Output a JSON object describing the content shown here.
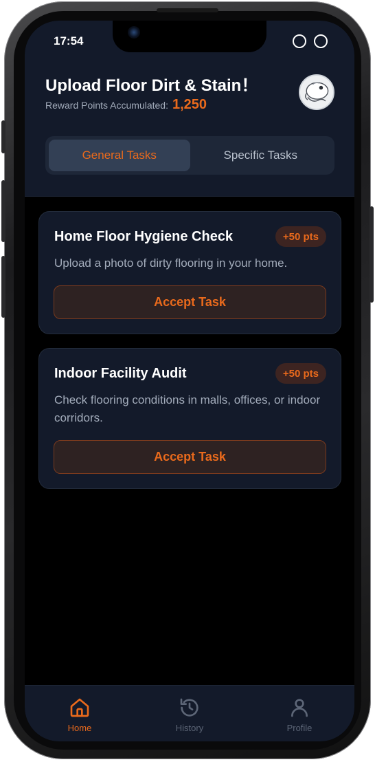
{
  "status_bar": {
    "time": "17:54"
  },
  "header": {
    "title": "Upload Floor Dirt & Stain！",
    "points_label": "Reward Points Accumulated:",
    "points_value": "1,250"
  },
  "tabs": [
    {
      "label": "General Tasks",
      "active": true
    },
    {
      "label": "Specific Tasks",
      "active": false
    }
  ],
  "tasks": [
    {
      "title": "Home Floor Hygiene Check",
      "points": "+50 pts",
      "description": "Upload a photo of dirty flooring in your home.",
      "button": "Accept Task"
    },
    {
      "title": "Indoor Facility Audit",
      "points": "+50 pts",
      "description": "Check flooring conditions in malls, offices, or indoor corridors.",
      "button": "Accept Task"
    }
  ],
  "bottom_nav": [
    {
      "label": "Home",
      "icon": "home-icon",
      "active": true
    },
    {
      "label": "History",
      "icon": "history-icon",
      "active": false
    },
    {
      "label": "Profile",
      "icon": "user-icon",
      "active": false
    }
  ],
  "colors": {
    "accent": "#ea6a1c",
    "background": "#000000",
    "surface": "#131a2a",
    "muted_text": "#a3acbb",
    "inactive_nav": "#5d6677"
  }
}
